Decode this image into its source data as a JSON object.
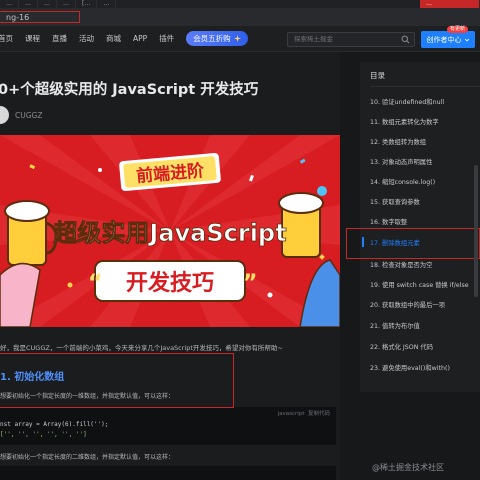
{
  "browser": {
    "tabs": [
      "…",
      "…",
      "…",
      "…",
      "[…",
      "…",
      "…"
    ],
    "url_text": "ng-16"
  },
  "header": {
    "nav": [
      "首页",
      "课程",
      "直播",
      "活动",
      "商城",
      "APP",
      "插件"
    ],
    "vip_label": "会员五折购",
    "search_placeholder": "探索稀土掘金",
    "creator_label": "创作者中心",
    "creator_badge": "有更新"
  },
  "article": {
    "title": "0+个超级实用的 JavaScript 开发技巧",
    "author": "CUGGZ",
    "banner": {
      "top_text": "前端进阶",
      "middle_text": "超级实用JavaScript",
      "bottom_text": "开发技巧"
    },
    "intro": "好，我是CUGGZ，一个前端的小菜鸡，今天来分享几个JavaScript开发技巧，希望对你有所帮助~",
    "section_heading": "1. 初始化数组",
    "p1": "想要初始化一个指定长度的一维数组，并指定默认值，可以这样：",
    "code1": {
      "lang": "javascript",
      "copy": "复制代码",
      "lines": [
        "nst array = Array(6).fill('');",
        "['', '', '', '', '', '']"
      ]
    },
    "p2": "想要初始化一个指定长度的二维数组，并指定默认值，可以这样："
  },
  "toc": {
    "title": "目录",
    "items": [
      "10. 验证undefined和null",
      "11. 数组元素转化为数字",
      "12. 类数组转为数组",
      "13. 对象动态声明属性",
      "14. 缩短console.log()",
      "15. 获取查询参数",
      "16. 数字取整",
      "17. 删除数组元素",
      "18. 检查对象是否为空",
      "19. 使用 switch case 替换 if/else",
      "20. 获取数组中的最后一项",
      "21. 值转为布尔值",
      "22. 格式化 JSON 代码",
      "23. 避免使用eval()和with()"
    ],
    "active_index": 7
  },
  "watermark": "@稀土掘金技术社区",
  "colors": {
    "accent": "#1e80ff",
    "banner_red": "#d71c22",
    "annotation_red": "#c62828"
  }
}
